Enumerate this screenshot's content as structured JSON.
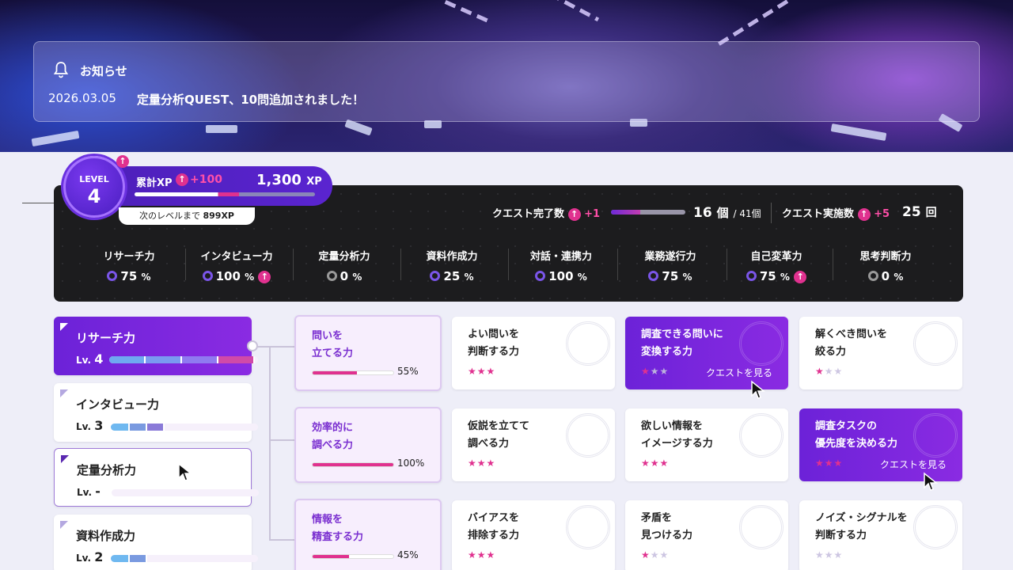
{
  "notice": {
    "title": "お知らせ",
    "date": "2026.03.05",
    "message": "定量分析QUEST、10問追加されました！"
  },
  "level": {
    "label": "LEVEL",
    "value": "4",
    "xp_label": "累計XP",
    "xp_gain": "+100",
    "xp_total": "1,300",
    "xp_unit": "XP",
    "xp_progress": 0.58,
    "next_prefix": "次のレベルまで",
    "next_value": "899XP"
  },
  "quest_stats": {
    "completed_label": "クエスト完了数",
    "completed_gain": "+1",
    "completed_value": "16",
    "completed_unit": "個",
    "completed_total": "/ 41個",
    "completed_progress": 0.39,
    "executed_label": "クエスト実施数",
    "executed_gain": "+5",
    "executed_value": "25",
    "executed_unit": "回"
  },
  "skills": [
    {
      "label": "リサーチ力",
      "pct": "75",
      "up": false
    },
    {
      "label": "インタビュー力",
      "pct": "100",
      "up": true
    },
    {
      "label": "定量分析力",
      "pct": "0",
      "up": false
    },
    {
      "label": "資料作成力",
      "pct": "25",
      "up": false
    },
    {
      "label": "対話・連携力",
      "pct": "100",
      "up": false
    },
    {
      "label": "業務遂行力",
      "pct": "75",
      "up": false
    },
    {
      "label": "自己変革力",
      "pct": "75",
      "up": true
    },
    {
      "label": "思考判断力",
      "pct": "0",
      "up": false
    }
  ],
  "pct_unit": "%",
  "lv_prefix": "Lv.",
  "skill_cards": [
    {
      "name": "リサーチ力",
      "level": "4"
    },
    {
      "name": "インタビュー力",
      "level": "3"
    },
    {
      "name": "定量分析力",
      "level": "-"
    },
    {
      "name": "資料作成力",
      "level": "2"
    }
  ],
  "categories": [
    {
      "title": "問いを\n立てる力",
      "pct": "55%",
      "progress": 0.55
    },
    {
      "title": "効率的に\n調べる力",
      "pct": "100%",
      "progress": 1.0
    },
    {
      "title": "情報を\n精査する力",
      "pct": "45%",
      "progress": 0.45
    }
  ],
  "quests": [
    {
      "title": "よい問いを\n判断する力",
      "stars": 3
    },
    {
      "title": "調査できる問いに\n変換する力",
      "stars": 1,
      "link": "クエストを見る"
    },
    {
      "title": "解くべき問いを\n絞る力",
      "stars": 1
    },
    {
      "title": "仮説を立てて\n調べる力",
      "stars": 3
    },
    {
      "title": "欲しい情報を\nイメージする力",
      "stars": 3
    },
    {
      "title": "調査タスクの\n優先度を決める力",
      "stars": 3,
      "link": "クエストを見る"
    },
    {
      "title": "バイアスを\n排除する力",
      "stars": 3
    },
    {
      "title": "矛盾を\n見つける力",
      "stars": 1
    },
    {
      "title": "ノイズ・シグナルを\n判断する力",
      "stars": 0
    }
  ],
  "star_glyph": "★"
}
